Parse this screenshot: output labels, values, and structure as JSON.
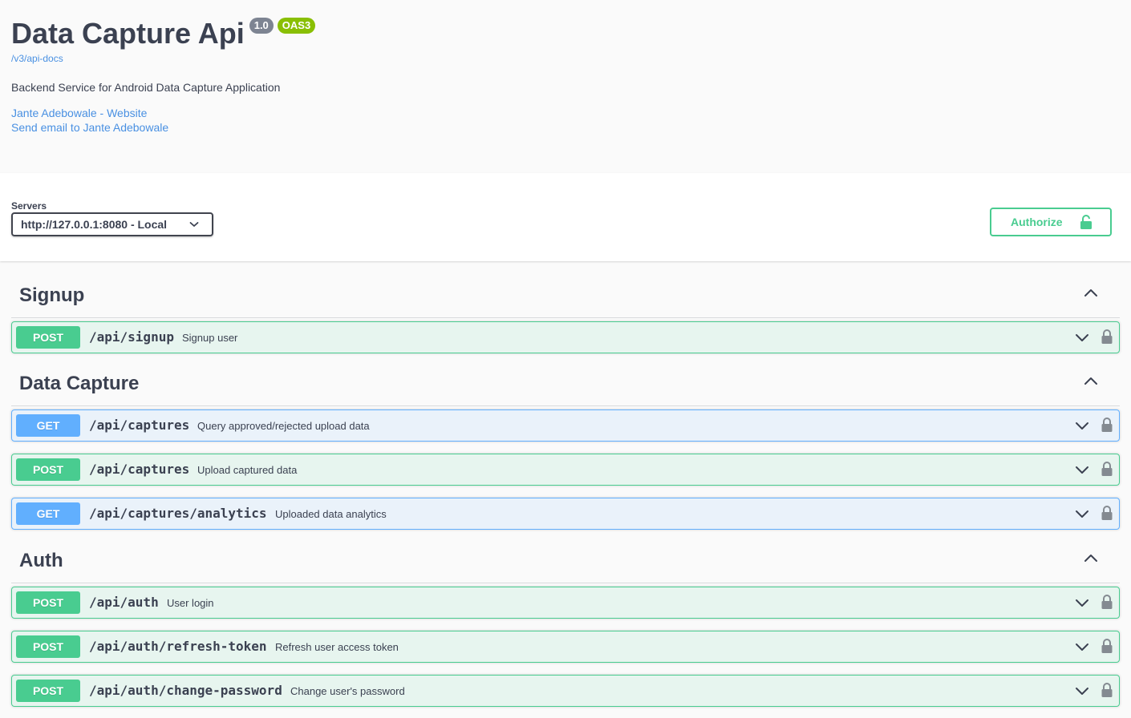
{
  "info": {
    "title": "Data Capture Api",
    "version_badge": "1.0",
    "oas_badge": "OAS3",
    "url": "/v3/api-docs",
    "description": "Backend Service for Android Data Capture Application",
    "contact_website": "Jante Adebowale - Website",
    "contact_email": "Send email to Jante Adebowale"
  },
  "scheme": {
    "servers_label": "Servers",
    "server_selected": "http://127.0.0.1:8080 - Local",
    "authorize_label": "Authorize"
  },
  "colors": {
    "post": "#49cc90",
    "get": "#61affe",
    "text": "#3b4151",
    "link": "#4990e2"
  },
  "tags": [
    {
      "name": "Signup",
      "operations": [
        {
          "method": "POST",
          "path": "/api/signup",
          "summary": "Signup user"
        }
      ]
    },
    {
      "name": "Data Capture",
      "operations": [
        {
          "method": "GET",
          "path": "/api/captures",
          "summary": "Query approved/rejected upload data"
        },
        {
          "method": "POST",
          "path": "/api/captures",
          "summary": "Upload captured data"
        },
        {
          "method": "GET",
          "path": "/api/captures/analytics",
          "summary": "Uploaded data analytics"
        }
      ]
    },
    {
      "name": "Auth",
      "operations": [
        {
          "method": "POST",
          "path": "/api/auth",
          "summary": "User login"
        },
        {
          "method": "POST",
          "path": "/api/auth/refresh-token",
          "summary": "Refresh user access token"
        },
        {
          "method": "POST",
          "path": "/api/auth/change-password",
          "summary": "Change user's password"
        }
      ]
    }
  ]
}
